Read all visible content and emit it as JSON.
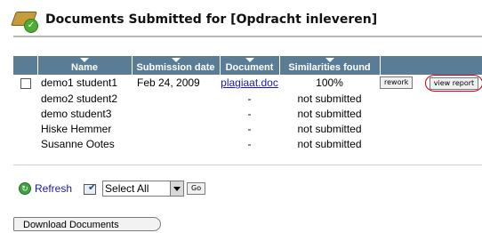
{
  "header": {
    "title": "Documents Submitted for [Opdracht inleveren]",
    "icon": "documents-folder-icon"
  },
  "table": {
    "columns": [
      "",
      "Name",
      "Submission date",
      "Document",
      "Similarities found",
      ""
    ],
    "rows": [
      {
        "name": "demo1 student1",
        "date": "Feb 24, 2009",
        "document": "plagiaat.doc",
        "similarity": "100%",
        "rework": "rework",
        "view": "view report",
        "has_checkbox": true
      },
      {
        "name": "demo2 student2",
        "date": "",
        "document": "-",
        "similarity": "not submitted",
        "has_checkbox": false
      },
      {
        "name": "demo student3",
        "date": "",
        "document": "-",
        "similarity": "not submitted",
        "has_checkbox": false
      },
      {
        "name": "Hiske Hemmer",
        "date": "",
        "document": "-",
        "similarity": "not submitted",
        "has_checkbox": false
      },
      {
        "name": "Susanne Ootes",
        "date": "",
        "document": "-",
        "similarity": "not submitted",
        "has_checkbox": false
      }
    ]
  },
  "toolbar": {
    "refresh_label": "Refresh",
    "select_value": "Select All",
    "go_label": "Go"
  },
  "download_label": "Download Documents",
  "colors": {
    "header_bg": "#5a7d95",
    "link": "#1a1aa8",
    "highlight_oval": "#d0001a"
  }
}
